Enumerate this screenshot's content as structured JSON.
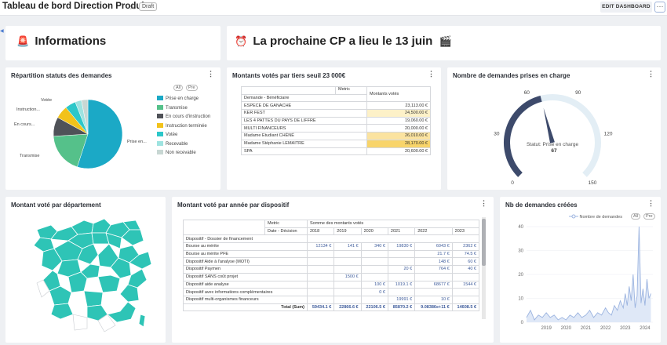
{
  "header": {
    "title": "Tableau de bord Direction Produit",
    "status_badge": "Draft",
    "edit_button": "EDIT DASHBOARD",
    "more_button": "···"
  },
  "banner_info": {
    "icon": "🚨",
    "text": "Informations"
  },
  "banner_cp": {
    "icon": "⏰",
    "text": "La prochaine CP a lieu le 13 juin",
    "icon_end": "🎬"
  },
  "pie_card": {
    "title": "Répartition statuts des demandes",
    "pager_prev": "All",
    "pager_next": "Pre",
    "chart_data": {
      "type": "pie",
      "slices": [
        {
          "label": "Prise en charge",
          "value": 55,
          "color": "#1ba9c6"
        },
        {
          "label": "Transmise",
          "value": 19,
          "color": "#55c18a"
        },
        {
          "label": "En cours d'instruction",
          "value": 9,
          "color": "#4f5258"
        },
        {
          "label": "Instruction terminée",
          "value": 6,
          "color": "#f2c21a"
        },
        {
          "label": "Votée",
          "value": 5,
          "color": "#2cc7c9"
        },
        {
          "label": "Recevable",
          "value": 3,
          "color": "#9ee3e0"
        },
        {
          "label": "Non recevable",
          "value": 3,
          "color": "#c8d7d3"
        }
      ],
      "slice_labels": [
        "Prise en...",
        "Transmise",
        "En cours...",
        "Instruction...",
        "Votée"
      ]
    }
  },
  "tiers_card": {
    "title": "Montants votés par tiers seuil 23 000€",
    "col_metric": "Metric",
    "col_values": "Montants votés",
    "row_header": "Demande - Bénéficiaire",
    "rows": [
      {
        "name": "ESPECE DE GANACHE",
        "value": "23,113.00 €",
        "shade": "#ffffff"
      },
      {
        "name": "KER FEST",
        "value": "24,500.00 €",
        "shade": "#fdf1c8"
      },
      {
        "name": "LES 4 PATTES DU PAYS DE LIFFRE",
        "value": "19,060.00 €",
        "shade": "#ffffff"
      },
      {
        "name": "MULTI FINANCEURS",
        "value": "20,000.00 €",
        "shade": "#ffffff"
      },
      {
        "name": "Madame Etudiant CHÉNÉ",
        "value": "26,010.00 €",
        "shade": "#fbe3a0"
      },
      {
        "name": "Madame Stéphanie LEMAITRE",
        "value": "28,170.00 €",
        "shade": "#f8d46a"
      },
      {
        "name": "SPA",
        "value": "20,600.00 €",
        "shade": "#ffffff"
      }
    ]
  },
  "gauge_card": {
    "title": "Nombre de demandes prises en charge",
    "tick_labels": [
      "0",
      "30",
      "60",
      "90",
      "120",
      "150"
    ],
    "value": 67,
    "value_label": "67",
    "status_label": "Statut: Prise en charge",
    "min": 0,
    "max": 150
  },
  "map_card": {
    "title": "Montant voté par département"
  },
  "dispositif_card": {
    "title": "Montant voté par année par dispositif",
    "metric_label": "Metric",
    "metric_value": "Somme des montants votés",
    "date_label": "Date - Décision",
    "row_header": "Dispositif - Dossier de financement",
    "years": [
      "2018",
      "2019",
      "2020",
      "2021",
      "2022",
      "2023"
    ],
    "rows": [
      {
        "name": "Bourse au mérite",
        "values": [
          "12134 €",
          "141 €",
          "340 €",
          "19830 €",
          "6043 €",
          "2362 €"
        ]
      },
      {
        "name": "Bourse au mérite PFE",
        "values": [
          "",
          "",
          "",
          "",
          "21.7 €",
          "74.5 €"
        ]
      },
      {
        "name": "Dispositif Aide à l'analyse (MOTI)",
        "values": [
          "",
          "",
          "",
          "",
          "148 €",
          "60 €"
        ]
      },
      {
        "name": "Dispositif Paymen",
        "values": [
          "",
          "",
          "",
          "20 €",
          "764 €",
          "40 €"
        ]
      },
      {
        "name": "Dispositif SANS coût projet",
        "values": [
          "",
          "1500 €",
          "",
          "",
          "",
          ""
        ]
      },
      {
        "name": "Dispositif aide analyse",
        "values": [
          "",
          "",
          "100 €",
          "1019.1 €",
          "68677 €",
          "1544 €"
        ]
      },
      {
        "name": "Dispositif avec informations complémentaires",
        "values": [
          "",
          "",
          "0 €",
          "",
          "",
          ""
        ]
      },
      {
        "name": "Dispositif multi-organismes financeurs",
        "values": [
          "",
          "",
          "",
          "19991 €",
          "10 €",
          ""
        ]
      }
    ],
    "total_label": "Total (Sum)",
    "totals": [
      "59434.1 €",
      "22866.6 €",
      "22106.5 €",
      "85870.2 €",
      "9.08386e+11 €",
      "14608.5 €"
    ]
  },
  "line_card": {
    "title": "Nb de demandes créées",
    "legend_label": "Nombre de demandes",
    "pager_prev": "All",
    "pager_next": "Pre",
    "chart_data": {
      "type": "area",
      "series": [
        {
          "name": "Nombre de demandes",
          "color": "#9cb4e0"
        }
      ],
      "ylim": [
        0,
        40
      ],
      "yticks": [
        "0",
        "10",
        "20",
        "30",
        "40"
      ],
      "xticks": [
        "2019",
        "2020",
        "2021",
        "2022",
        "2023",
        "2024"
      ],
      "xrange": [
        2018.0,
        2024.4
      ],
      "points": [
        [
          2018.0,
          2
        ],
        [
          2018.2,
          5
        ],
        [
          2018.4,
          1
        ],
        [
          2018.6,
          3
        ],
        [
          2018.8,
          2
        ],
        [
          2019.0,
          4
        ],
        [
          2019.2,
          2
        ],
        [
          2019.4,
          3
        ],
        [
          2019.6,
          1
        ],
        [
          2019.8,
          2
        ],
        [
          2020.0,
          1
        ],
        [
          2020.2,
          3
        ],
        [
          2020.4,
          2
        ],
        [
          2020.6,
          4
        ],
        [
          2020.8,
          2
        ],
        [
          2021.0,
          3
        ],
        [
          2021.2,
          5
        ],
        [
          2021.4,
          2
        ],
        [
          2021.6,
          4
        ],
        [
          2021.8,
          3
        ],
        [
          2022.0,
          6
        ],
        [
          2022.15,
          4
        ],
        [
          2022.3,
          3
        ],
        [
          2022.45,
          7
        ],
        [
          2022.6,
          5
        ],
        [
          2022.75,
          9
        ],
        [
          2022.9,
          6
        ],
        [
          2023.0,
          12
        ],
        [
          2023.1,
          7
        ],
        [
          2023.2,
          15
        ],
        [
          2023.3,
          9
        ],
        [
          2023.4,
          20
        ],
        [
          2023.5,
          6
        ],
        [
          2023.6,
          11
        ],
        [
          2023.7,
          40
        ],
        [
          2023.8,
          8
        ],
        [
          2023.9,
          14
        ],
        [
          2024.0,
          7
        ],
        [
          2024.1,
          18
        ],
        [
          2024.2,
          10
        ],
        [
          2024.3,
          12
        ]
      ]
    }
  }
}
